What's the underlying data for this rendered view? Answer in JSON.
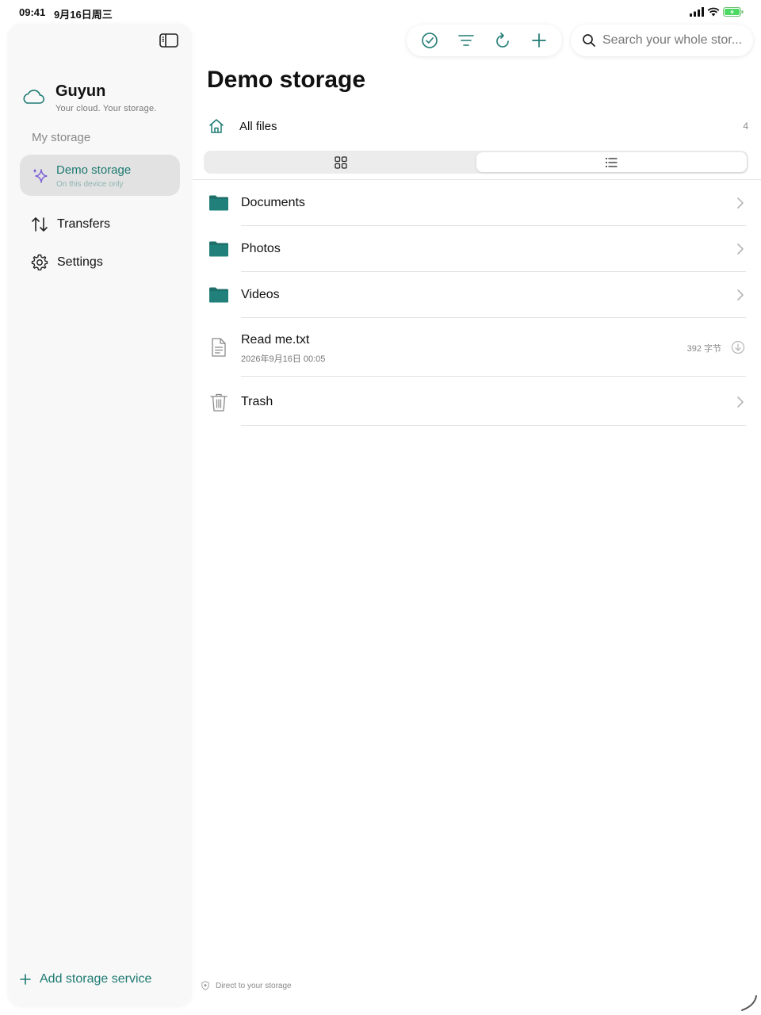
{
  "status_bar": {
    "time": "09:41",
    "date": "9月16日周三"
  },
  "sidebar": {
    "brand_name": "Guyun",
    "brand_tagline": "Your cloud. Your storage.",
    "section_label": "My storage",
    "storage": {
      "name": "Demo storage",
      "subtitle": "On this device only"
    },
    "nav": [
      {
        "label": "Transfers",
        "icon": "transfer-arrows-icon"
      },
      {
        "label": "Settings",
        "icon": "gear-icon"
      }
    ],
    "add_service_label": "Add storage service"
  },
  "toolbar": {
    "icons": [
      "select-check-icon",
      "sort-filter-icon",
      "refresh-icon",
      "add-icon"
    ],
    "search_placeholder": "Search your whole stor..."
  },
  "main": {
    "title": "Demo storage",
    "breadcrumb_label": "All files",
    "item_count": "4",
    "view_modes": [
      "grid",
      "list"
    ],
    "active_view": "list",
    "items": [
      {
        "name": "Documents",
        "type": "folder"
      },
      {
        "name": "Photos",
        "type": "folder"
      },
      {
        "name": "Videos",
        "type": "folder"
      },
      {
        "name": "Read me.txt",
        "type": "file",
        "date": "2026年9月16日 00:05",
        "size": "392 字节"
      },
      {
        "name": "Trash",
        "type": "trash"
      }
    ],
    "footer_note": "Direct to your storage"
  },
  "colors": {
    "accent": "#1e7a72",
    "folder": "#1d6f6a",
    "sparkle": "#7b5fd6"
  }
}
